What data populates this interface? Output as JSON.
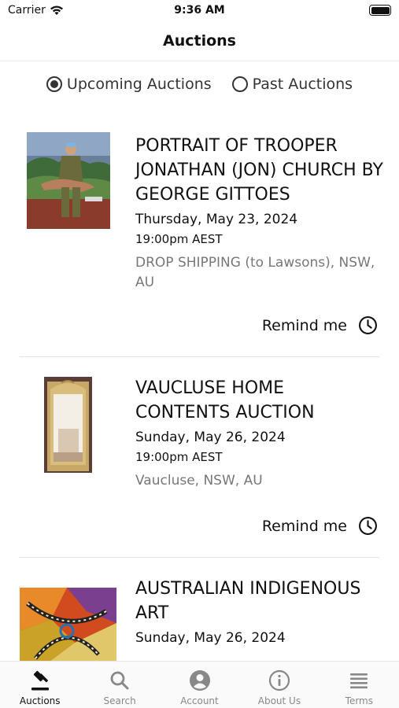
{
  "status_bar": {
    "carrier": "Carrier",
    "time": "9:36 AM"
  },
  "nav": {
    "title": "Auctions"
  },
  "filters": {
    "upcoming_label": "Upcoming Auctions",
    "past_label": "Past Auctions",
    "selected": "upcoming"
  },
  "auctions": [
    {
      "title": "PORTRAIT OF TROOPER JONATHAN (JON) CHURCH BY GEORGE GITTOES",
      "date": "Thursday, May 23, 2024",
      "time": "19:00pm AEST",
      "location": "DROP SHIPPING (to Lawsons), NSW, AU",
      "remind_label": "Remind me"
    },
    {
      "title": "VAUCLUSE HOME CONTENTS AUCTION",
      "date": "Sunday, May 26, 2024",
      "time": "19:00pm AEST",
      "location": "Vaucluse, NSW, AU",
      "remind_label": "Remind me"
    },
    {
      "title": "AUSTRALIAN INDIGENOUS ART",
      "date": "Sunday, May 26, 2024"
    }
  ],
  "tabs": [
    {
      "label": "Auctions",
      "icon": "gavel-icon",
      "active": true
    },
    {
      "label": "Search",
      "icon": "search-icon",
      "active": false
    },
    {
      "label": "Account",
      "icon": "account-icon",
      "active": false
    },
    {
      "label": "About Us",
      "icon": "info-icon",
      "active": false
    },
    {
      "label": "Terms",
      "icon": "terms-icon",
      "active": false
    }
  ]
}
